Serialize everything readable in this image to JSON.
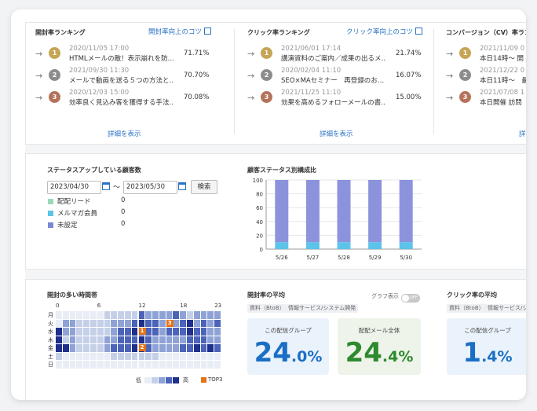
{
  "open_ranking": {
    "title": "開封率ランキング",
    "tip": "開封率向上のコツ",
    "more": "詳細を表示",
    "rows": [
      {
        "rank": "1",
        "date": "2020/11/05 17:00",
        "text": "HTMLメールの敵！表示崩れを防…",
        "pct": "71.71%"
      },
      {
        "rank": "2",
        "date": "2021/09/30 11:30",
        "text": "メールで動画を送る５つの方法と…",
        "pct": "70.70%"
      },
      {
        "rank": "3",
        "date": "2020/12/03 15:00",
        "text": "効率良く見込み客を獲得する手法…",
        "pct": "70.08%"
      }
    ]
  },
  "click_ranking": {
    "title": "クリック率ランキング",
    "tip": "クリック率向上のコツ",
    "more": "詳細を表示",
    "rows": [
      {
        "rank": "1",
        "date": "2021/06/01 17:14",
        "text": "講演資料のご案内／成果の出るメ…",
        "pct": "21.74%"
      },
      {
        "rank": "2",
        "date": "2020/02/04 11:10",
        "text": "SEO×MAセミナー　再登録のお…",
        "pct": "16.07%"
      },
      {
        "rank": "3",
        "date": "2021/11/25 11:10",
        "text": "効果を高めるフォローメールの書…",
        "pct": "15.00%"
      }
    ]
  },
  "cv_ranking": {
    "title": "コンバージョン（CV）率ラン",
    "more": "詳細",
    "rows": [
      {
        "rank": "1",
        "date": "2021/11/09 0",
        "text": "本日14時〜 開"
      },
      {
        "rank": "2",
        "date": "2021/12/22 0",
        "text": "本日11時〜　最"
      },
      {
        "rank": "3",
        "date": "2021/07/08 1",
        "text": "本日開催 訪問"
      }
    ]
  },
  "status_up": {
    "title": "ステータスアップしている顧客数",
    "date_from": "2023/04/30",
    "tilde": "〜",
    "date_to": "2023/05/30",
    "search_label": "検索",
    "legend": [
      {
        "label": "配配リード",
        "count": "0",
        "color": "#9bd9b6"
      },
      {
        "label": "メルマガ会員",
        "count": "0",
        "color": "#5cc4e8"
      },
      {
        "label": "未設定",
        "count": "0",
        "color": "#7b87d6"
      }
    ]
  },
  "status_chart": {
    "chart_data": {
      "type": "bar",
      "title": "顧客ステータス別構成比",
      "categories": [
        "5/26",
        "5/27",
        "5/28",
        "5/29",
        "5/30"
      ],
      "series": [
        {
          "name": "メルマガ会員",
          "values": [
            10,
            10,
            10,
            10,
            10
          ]
        },
        {
          "name": "未設定",
          "values": [
            90,
            90,
            90,
            90,
            90
          ]
        }
      ],
      "yticks": [
        "0",
        "20",
        "40",
        "60",
        "80",
        "100"
      ],
      "ylim": [
        0,
        100
      ],
      "colors": [
        "#5cc4e8",
        "#8c93dd"
      ]
    }
  },
  "heatmap": {
    "title": "開封の多い時間帯",
    "hour_labels": [
      "0",
      "6",
      "12",
      "18",
      "23"
    ],
    "days": [
      "月",
      "火",
      "水",
      "木",
      "金",
      "土",
      "日"
    ],
    "legend_low": "低",
    "legend_high": "高",
    "legend_top": "TOP3",
    "top_marks": [
      "1",
      "2",
      "3"
    ],
    "levels": [
      [
        0,
        0,
        0,
        0,
        0,
        0,
        0,
        1,
        1,
        1,
        1,
        1,
        3,
        2,
        2,
        2,
        2,
        3,
        2,
        1,
        2,
        2,
        2,
        2
      ],
      [
        0,
        2,
        2,
        1,
        1,
        1,
        1,
        1,
        2,
        2,
        2,
        3,
        4,
        3,
        3,
        2,
        2,
        2,
        3,
        4,
        2,
        3,
        2,
        3
      ],
      [
        4,
        2,
        2,
        1,
        1,
        1,
        1,
        1,
        2,
        3,
        3,
        4,
        3,
        3,
        3,
        2,
        3,
        3,
        3,
        4,
        3,
        3,
        2,
        2
      ],
      [
        4,
        1,
        2,
        1,
        1,
        1,
        1,
        2,
        2,
        3,
        3,
        3,
        4,
        3,
        2,
        2,
        2,
        2,
        2,
        3,
        3,
        3,
        2,
        2
      ],
      [
        4,
        4,
        2,
        1,
        1,
        1,
        1,
        2,
        3,
        3,
        3,
        4,
        4,
        3,
        2,
        2,
        2,
        2,
        3,
        3,
        4,
        3,
        4,
        3
      ],
      [
        1,
        0,
        0,
        0,
        0,
        0,
        0,
        0,
        1,
        1,
        1,
        1,
        1,
        1,
        1,
        0,
        0,
        0,
        0,
        0,
        0,
        0,
        0,
        0
      ],
      [
        0,
        0,
        0,
        0,
        0,
        0,
        0,
        0,
        0,
        0,
        0,
        0,
        0,
        0,
        0,
        0,
        0,
        0,
        0,
        0,
        0,
        0,
        0,
        0
      ]
    ],
    "scale": [
      "#e9edf5",
      "#c5d0e8",
      "#8ea2d6",
      "#4b63b8",
      "#1f2f8c"
    ]
  },
  "open_avg": {
    "title": "開封率の平均",
    "graph_label": "グラフ表示",
    "toggle_label": "OFF",
    "tags": [
      "資料（BtoB）",
      "情報サービス/システム開発"
    ],
    "group_label": "この配信グループ",
    "group_int": "24",
    "group_dec": ".0%",
    "all_label": "配配メール全体",
    "all_int": "24",
    "all_dec": ".4%",
    "group_color": "#1a6fc4",
    "all_color": "#2e8a2e"
  },
  "click_avg": {
    "title": "クリック率の平均",
    "tags": [
      "資料（BtoB）",
      "情報サービス/シ"
    ],
    "group_label": "この配信グループ",
    "group_int": "1",
    "group_dec": ".4%"
  }
}
